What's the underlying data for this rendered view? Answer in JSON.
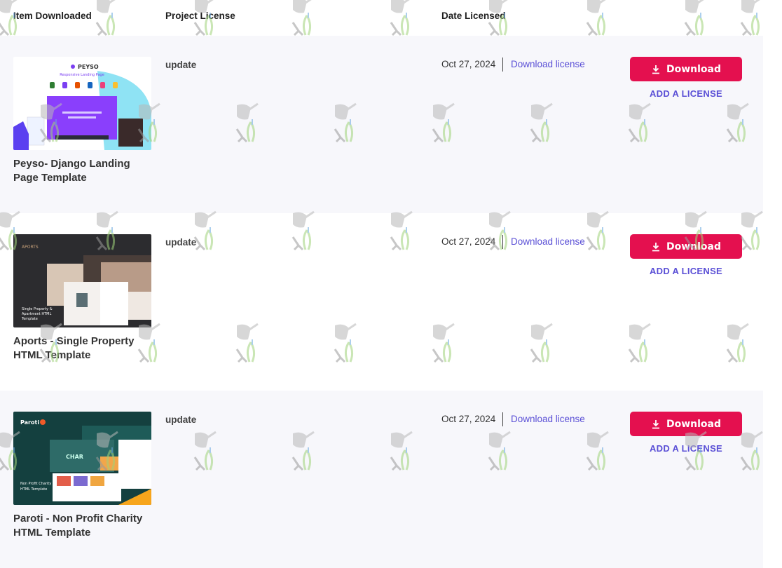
{
  "headers": {
    "item": "Item Downloaded",
    "license": "Project License",
    "date": "Date Licensed"
  },
  "rows": [
    {
      "title": "Peyso- Django Landing Page Template",
      "license": "update",
      "date": "Oct 27, 2024",
      "license_link": "Download license",
      "download_label": "Download",
      "add_license_label": "ADD A LICENSE",
      "thumb": {
        "brand": "PEYSO",
        "subtitle": "Responsive Landing Page",
        "accent": "#7b3ff2"
      }
    },
    {
      "title": "Aports - Single Property HTML Template",
      "license": "update",
      "date": "Oct 27, 2024",
      "license_link": "Download license",
      "download_label": "Download",
      "add_license_label": "ADD A LICENSE",
      "thumb": {
        "brand": "APORTS",
        "caption": "Single Property & Apartment HTML Template",
        "accent": "#2c2c2f"
      }
    },
    {
      "title": "Paroti - Non Profit Charity HTML Template",
      "license": "update",
      "date": "Oct 27, 2024",
      "license_link": "Download license",
      "download_label": "Download",
      "add_license_label": "ADD A LICENSE",
      "thumb": {
        "brand": "Paroti",
        "caption": "Non Profit Charity HTML Template",
        "accent": "#14403f"
      }
    }
  ],
  "colors": {
    "download_button": "#e4104f",
    "link": "#5a4fd6",
    "shaded_row": "#f7f7fb"
  },
  "icons": {
    "download": "download-icon",
    "watermark": "watering-can-watermark-icon"
  }
}
